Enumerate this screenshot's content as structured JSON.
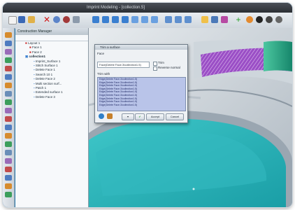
{
  "app": {
    "title": "Imprint Modeling - [collection.5]",
    "accent": "#2a83b6"
  },
  "construction_manager": {
    "title": "Construction Manager",
    "tree": [
      "Layout 1",
      "Face 1",
      "Face 2",
      "collection1",
      "Imprint_Surface 1",
      "Stitch Surface 1",
      "Delete Face 1",
      "Search 10 1",
      "Delete Face 2",
      "Multi section surf...",
      "Patch 1",
      "Extended surface 1",
      "Delete Face 3"
    ]
  },
  "dialog": {
    "title": "Trim a surface",
    "face_label": "Face",
    "face_value": "Face(Delete Face.3\\collection1.5)",
    "option_1": "Trim",
    "option_2": "Reverse normal",
    "list_label": "Trim with",
    "items": [
      "Edge(Delete Face.3\\collection1.5)",
      "Edge(Delete Face.3\\collection1.5)",
      "Edge(Delete Face.3\\collection1.5)",
      "Edge(Delete Face.3\\collection1.5)",
      "Edge(Delete Face.3\\collection1.5)",
      "Edge(Delete Face.3\\collection1.5)",
      "Edge(Delete Face.3\\collection1.5)",
      "Edge(Delete Face.3\\collection1.5)",
      "Edge(Delete Face.3\\collection1.5)"
    ],
    "accept_label": "Accept",
    "cancel_label": "Cancel"
  }
}
